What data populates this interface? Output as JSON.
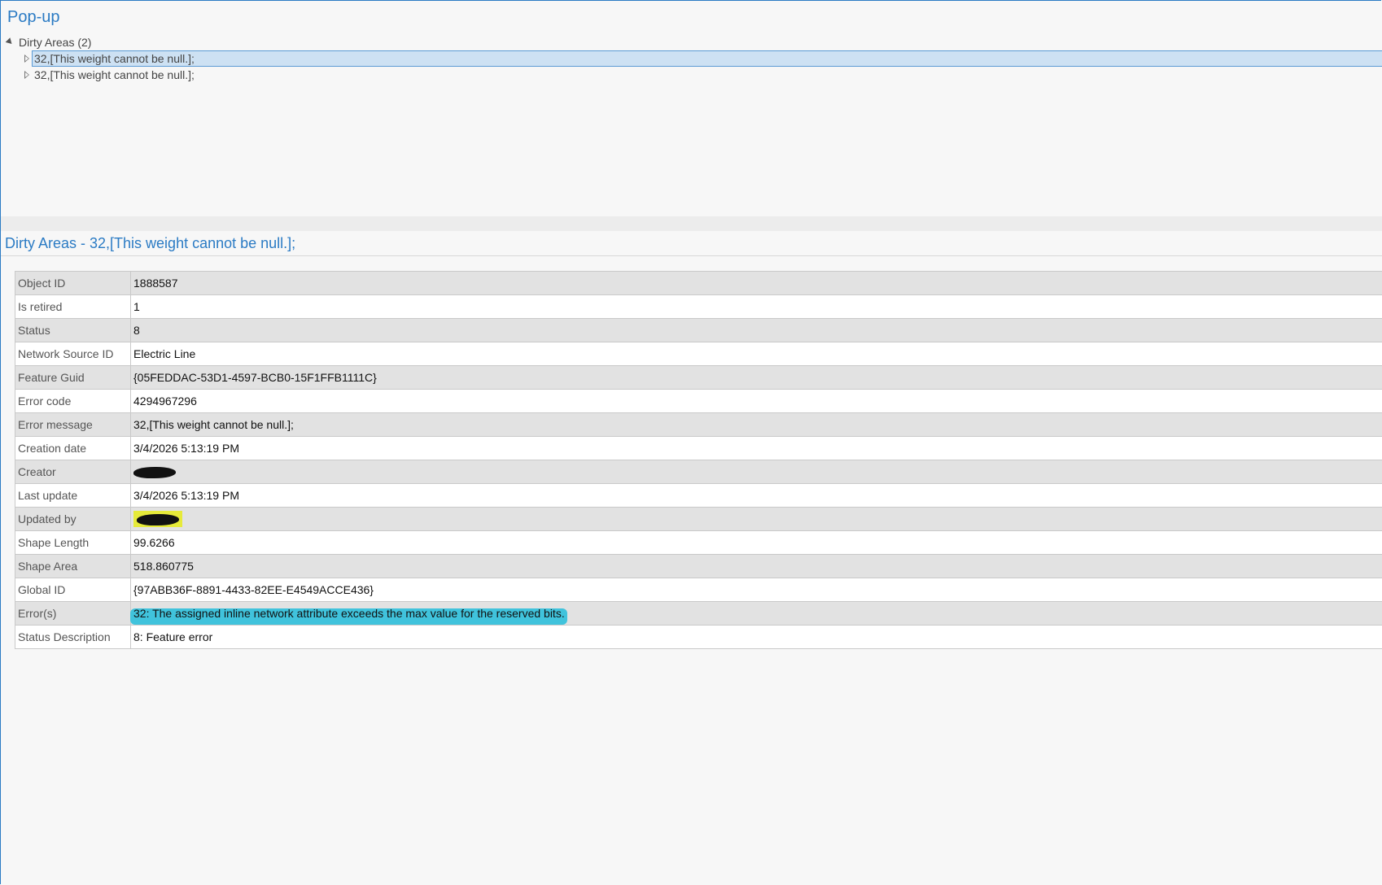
{
  "popup": {
    "title": "Pop-up"
  },
  "tree": {
    "root_label": "Dirty Areas (2)",
    "children": [
      {
        "label": "32,[This weight cannot be null.];",
        "selected": true
      },
      {
        "label": "32,[This weight cannot be null.];",
        "selected": false
      }
    ]
  },
  "details": {
    "title": "Dirty Areas - 32,[This weight cannot be null.];",
    "rows": [
      {
        "key": "Object ID",
        "value": "1888587"
      },
      {
        "key": "Is retired",
        "value": "1"
      },
      {
        "key": "Status",
        "value": "8"
      },
      {
        "key": "Network Source ID",
        "value": "Electric Line"
      },
      {
        "key": "Feature Guid",
        "value": "{05FEDDAC-53D1-4597-BCB0-15F1FFB1111C}"
      },
      {
        "key": "Error code",
        "value": "4294967296"
      },
      {
        "key": "Error message",
        "value": "32,[This weight cannot be null.];"
      },
      {
        "key": "Creation date",
        "value": "3/4/2026 5:13:19 PM"
      },
      {
        "key": "Creator",
        "value": ""
      },
      {
        "key": "Last update",
        "value": "3/4/2026 5:13:19 PM"
      },
      {
        "key": "Updated by",
        "value": ""
      },
      {
        "key": "Shape Length",
        "value": "99.6266"
      },
      {
        "key": "Shape Area",
        "value": "518.860775"
      },
      {
        "key": "Global ID",
        "value": "{97ABB36F-8891-4433-82EE-E4549ACCE436}"
      },
      {
        "key": "Error(s)",
        "value": "32: The assigned inline network attribute exceeds the max value for the reserved bits."
      },
      {
        "key": "Status Description",
        "value": "8: Feature error"
      }
    ]
  },
  "colors": {
    "accent": "#2b7bc4",
    "selection_fill": "#cde1f3",
    "highlight_yellow": "#e6ea3a",
    "highlight_cyan": "#2fc0dc"
  }
}
